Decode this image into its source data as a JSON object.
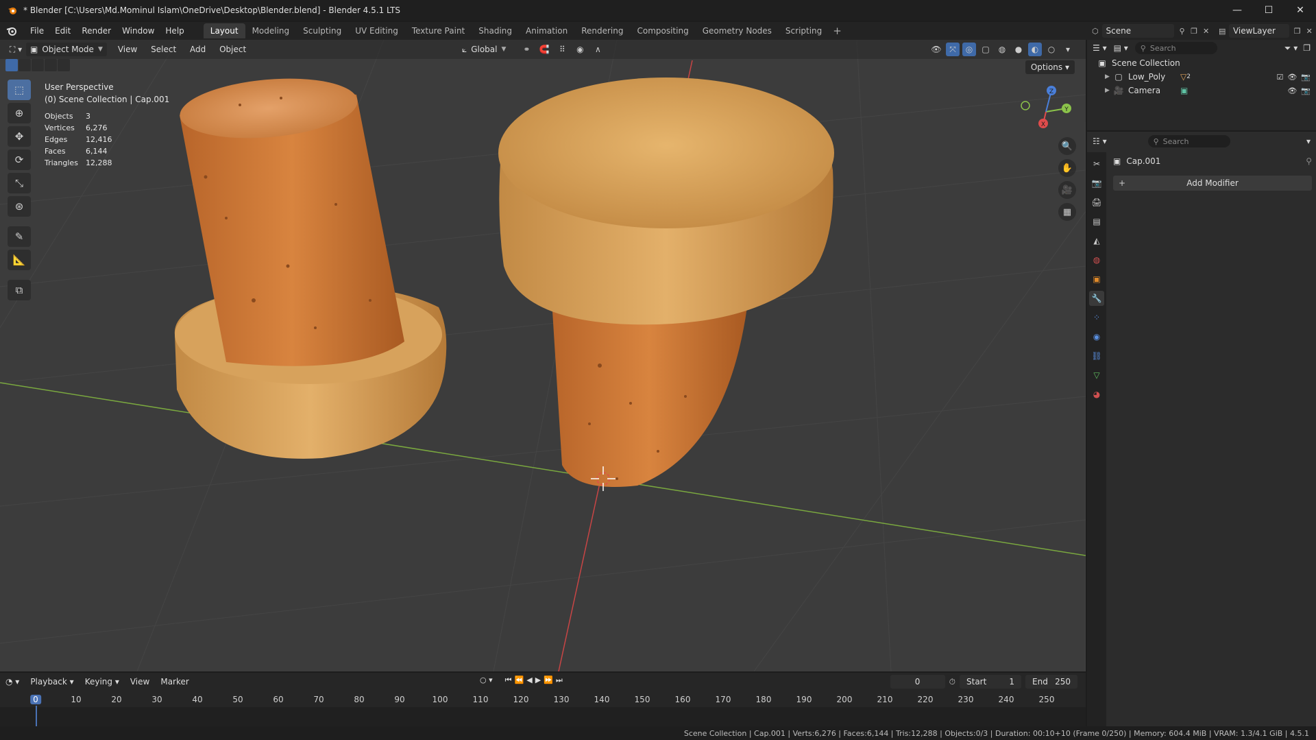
{
  "window": {
    "title": "* Blender [C:\\Users\\Md.Mominul Islam\\OneDrive\\Desktop\\Blender.blend] - Blender 4.5.1 LTS",
    "controls": [
      "—",
      "☐",
      "✕"
    ]
  },
  "menu": [
    "File",
    "Edit",
    "Render",
    "Window",
    "Help"
  ],
  "workspaces": [
    "Layout",
    "Modeling",
    "Sculpting",
    "UV Editing",
    "Texture Paint",
    "Shading",
    "Animation",
    "Rendering",
    "Compositing",
    "Geometry Nodes",
    "Scripting"
  ],
  "active_workspace": "Layout",
  "scene": {
    "name": "Scene",
    "view_layer": "ViewLayer"
  },
  "viewport": {
    "mode": "Object Mode",
    "menus": [
      "View",
      "Select",
      "Add",
      "Object"
    ],
    "transform_orientation": "Global",
    "options_label": "Options",
    "perspective": "User Perspective",
    "collection_info": "(0) Scene Collection | Cap.001",
    "stats": [
      {
        "label": "Objects",
        "value": "3"
      },
      {
        "label": "Vertices",
        "value": "6,276"
      },
      {
        "label": "Edges",
        "value": "12,416"
      },
      {
        "label": "Faces",
        "value": "6,144"
      },
      {
        "label": "Triangles",
        "value": "12,288"
      }
    ],
    "gizmo_axes": {
      "x": "X",
      "y": "Y",
      "z": "Z"
    }
  },
  "timeline": {
    "menus": [
      "Playback",
      "Keying",
      "View",
      "Marker"
    ],
    "current_frame": "0",
    "start_label": "Start",
    "start": "1",
    "end_label": "End",
    "end": "250",
    "ruler": [
      "0",
      "10",
      "20",
      "30",
      "40",
      "50",
      "60",
      "70",
      "80",
      "90",
      "100",
      "110",
      "120",
      "130",
      "140",
      "150",
      "160",
      "170",
      "180",
      "190",
      "200",
      "210",
      "220",
      "230",
      "240",
      "250"
    ]
  },
  "outliner": {
    "search_placeholder": "Search",
    "root": "Scene Collection",
    "items": [
      {
        "name": "Low_Poly",
        "badge": "2"
      },
      {
        "name": "Camera"
      }
    ]
  },
  "properties": {
    "search_placeholder": "Search",
    "object_name": "Cap.001",
    "add_modifier": "Add Modifier"
  },
  "status_bar": "Scene Collection | Cap.001 | Verts:6,276 | Faces:6,144 | Tris:12,288 | Objects:0/3 | Duration: 00:10+10 (Frame 0/250) | Memory: 604.4 MiB | VRAM: 1.3/4.1 GiB | 4.5.1",
  "colors": {
    "accent": "#4a72b5",
    "axis_x": "#e04c4c",
    "axis_y": "#8bc34a",
    "axis_z": "#4a7fd9",
    "cork_dark": "#c9782f",
    "cork_light": "#d9a45a"
  }
}
